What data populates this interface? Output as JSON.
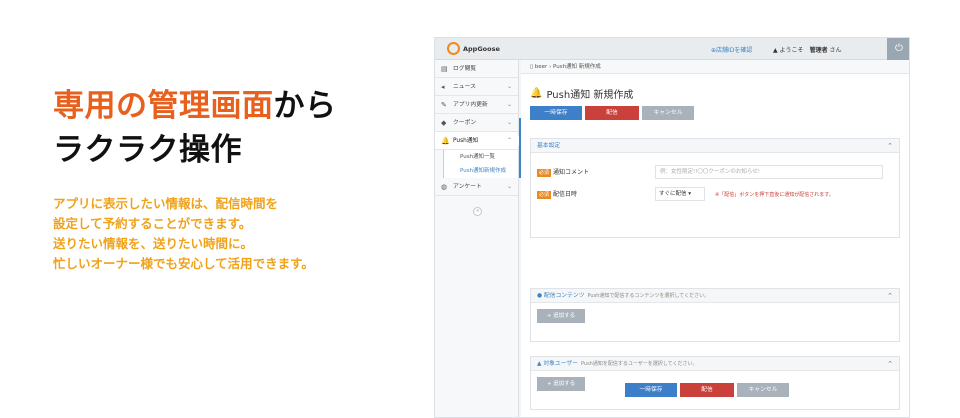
{
  "promo": {
    "headline_part1": "専用の管理画面",
    "headline_part2": "から",
    "headline_line2": "ラクラク操作",
    "desc_lines": [
      "アプリに表示したい情報は、配信時間を",
      "設定して予約することができます。",
      "送りたい情報を、送りたい時間に。",
      "忙しいオーナー様でも安心して活用できます。"
    ],
    "accent_color": "#e8601e",
    "desc_color": "#f0a21b"
  },
  "app": {
    "logo": "AppGoose",
    "store_link": "⊕店舗IDを確認",
    "welcome_prefix": "ようこそ",
    "welcome_user": "管理者",
    "welcome_suffix": "さん",
    "power_icon": "⏻",
    "sidebar": {
      "items": [
        {
          "icon": "▤",
          "label": "ログ閲覧",
          "chevron": ""
        },
        {
          "icon": "◂",
          "label": "ニュース",
          "chevron": "⌄"
        },
        {
          "icon": "✎",
          "label": "アプリ内更新",
          "chevron": "⌄"
        },
        {
          "icon": "◆",
          "label": "クーポン",
          "chevron": "⌄"
        },
        {
          "icon": "🔔",
          "label": "Push通知",
          "chevron": "⌃"
        },
        {
          "icon": "◍",
          "label": "アンケート",
          "chevron": "⌄"
        }
      ],
      "subitems": [
        "Push通知一覧",
        "Push通知新規作成"
      ],
      "collapse": "«"
    },
    "breadcrumb": "beer  ›  Push通知 新規作成",
    "title": "Push通知 新規作成",
    "buttons": {
      "save": "一時保存",
      "send": "配信",
      "cancel": "キャンセル"
    },
    "basic": {
      "header": "基本設定",
      "required_tag": "必須",
      "comment_label": "通知コメント",
      "comment_placeholder": "例：女性限定!!〇〇クーポンのお知らせ!",
      "date_label": "配信日時",
      "date_value": "すぐに配信 ▾",
      "note": "※「配信」ボタンを押下直後に通知が配信されます。"
    },
    "content": {
      "header": "配信コンテンツ",
      "hint": "Push通知で配信するコンテンツを選択してください。",
      "add": "+ 追加する"
    },
    "target": {
      "header": "対象ユーザー",
      "hint": "Push通知を配信するユーザーを選択してください。",
      "add": "+ 追加する"
    }
  }
}
